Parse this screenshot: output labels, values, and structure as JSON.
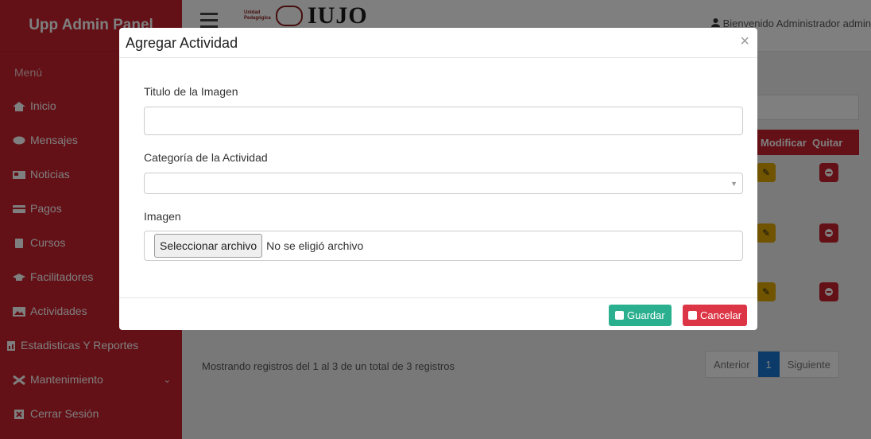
{
  "app": {
    "brand": "Upp Admin Panel"
  },
  "sidebar": {
    "menu_label": "Menú",
    "items": [
      {
        "label": "Inicio",
        "icon": "home-icon"
      },
      {
        "label": "Mensajes",
        "icon": "chat-bubble-icon"
      },
      {
        "label": "Noticias",
        "icon": "newspaper-icon"
      },
      {
        "label": "Pagos",
        "icon": "credit-card-icon"
      },
      {
        "label": "Cursos",
        "icon": "book-icon"
      },
      {
        "label": "Facilitadores",
        "icon": "graduation-cap-icon"
      },
      {
        "label": "Actividades",
        "icon": "image-icon"
      },
      {
        "label": "Estadisticas Y Reportes",
        "icon": "file-chart-icon"
      },
      {
        "label": "Mantenimiento",
        "icon": "tools-icon"
      },
      {
        "label": "Cerrar Sesión",
        "icon": "close-box-icon"
      }
    ]
  },
  "header": {
    "logo_small": "Unidad Pedagógica",
    "logo_text": "IUJO",
    "welcome": "Bienvenido Administrador admin"
  },
  "table": {
    "headers": [
      "Modificar",
      "Quitar"
    ]
  },
  "footer": {
    "records": "Mostrando registros del 1 al 3 de un total de 3 registros",
    "pagination": {
      "prev": "Anterior",
      "page": "1",
      "next": "Siguiente"
    }
  },
  "modal": {
    "title": "Agregar Actividad",
    "close": "×",
    "fields": {
      "title_label": "Titulo de la Imagen",
      "title_value": "",
      "category_label": "Categoría de la Actividad",
      "category_value": "",
      "image_label": "Imagen",
      "file_button": "Seleccionar archivo",
      "file_status": "No se eligió archivo"
    },
    "buttons": {
      "save": "Guardar",
      "cancel": "Cancelar"
    }
  },
  "colors": {
    "sidebar": "#c6212d",
    "save": "#2bb08f",
    "cancel": "#dc3545",
    "active_page": "#1976d2"
  }
}
